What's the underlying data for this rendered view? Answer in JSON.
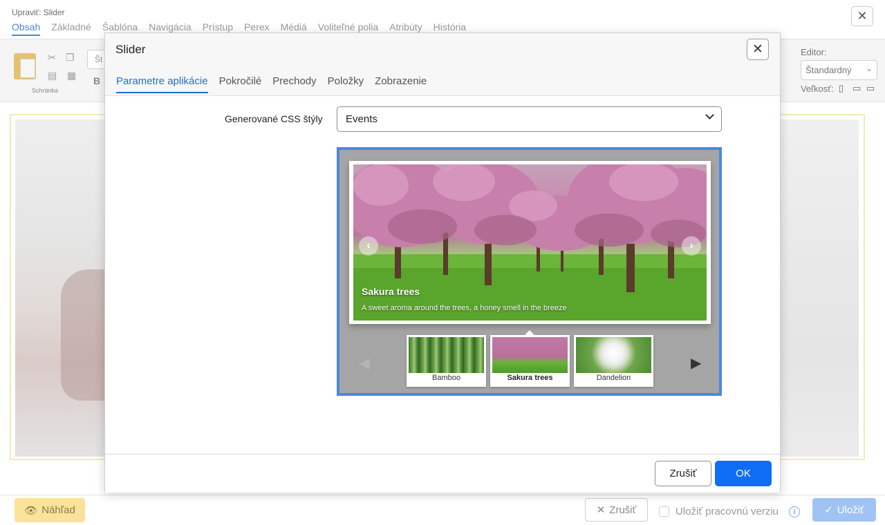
{
  "background": {
    "window_title": "Upraviť: Slider",
    "close_glyph": "✕",
    "tabs": [
      "Obsah",
      "Základné",
      "Šablóna",
      "Navigácia",
      "Prístup",
      "Perex",
      "Médiá",
      "Voliteľné polia",
      "Atribúty",
      "História"
    ],
    "active_tab": "Obsah",
    "toolbar": {
      "clipboard_label": "Schránka",
      "style_placeholder": "Št",
      "bold_label": "B",
      "editor_label": "Editor:",
      "editor_value": "Štandardný",
      "size_label": "Veľkosť:"
    },
    "footer": {
      "preview_label": "Náhľad",
      "cancel_label": "Zrušiť",
      "save_draft_label": "Uložiť pracovnú verziu",
      "save_label": "Uložiť"
    }
  },
  "modal": {
    "title": "Slider",
    "close_glyph": "✕",
    "tabs": [
      {
        "label": "Parametre aplikácie",
        "active": true
      },
      {
        "label": "Pokročilé",
        "active": false
      },
      {
        "label": "Prechody",
        "active": false
      },
      {
        "label": "Položky",
        "active": false
      },
      {
        "label": "Zobrazenie",
        "active": false
      }
    ],
    "css_styles_label": "Generované CSS štýly",
    "css_styles_value": "Events",
    "preview": {
      "slide_title": "Sakura trees",
      "slide_text": "A sweet aroma around the trees, a honey smell in the breeze",
      "thumbnails": [
        {
          "label": "Bamboo",
          "active": false
        },
        {
          "label": "Sakura trees",
          "active": true
        },
        {
          "label": "Dandelion",
          "active": false
        }
      ]
    },
    "footer": {
      "cancel_label": "Zrušiť",
      "ok_label": "OK"
    }
  },
  "colors": {
    "accent": "#0e6ef5",
    "tab_active": "#1f6fd1",
    "preview_border": "#4a87e4",
    "preview_btn_yellow": "#fbe29a",
    "save_btn_disabled": "#9fc3f3"
  }
}
